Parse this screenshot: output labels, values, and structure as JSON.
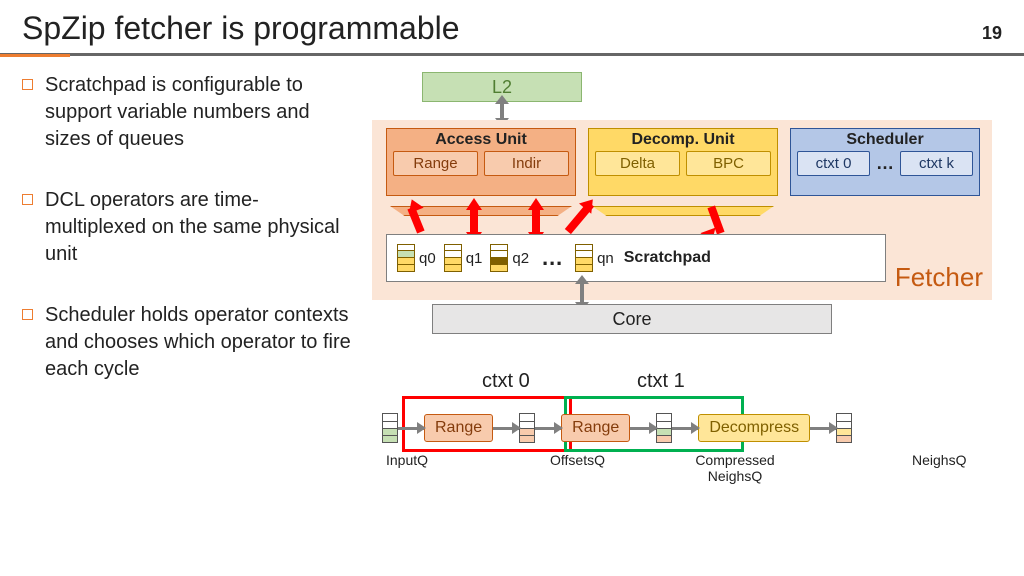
{
  "title": "SpZip fetcher is programmable",
  "page_number": "19",
  "bullets": [
    "Scratchpad is configurable to support variable numbers and sizes of queues",
    "DCL operators are time-multiplexed on the same physical unit",
    "Scheduler holds operator contexts and chooses which operator to fire each cycle"
  ],
  "diagram1": {
    "l2": "L2",
    "fetcher": "Fetcher",
    "access_unit": {
      "title": "Access Unit",
      "sub": [
        "Range",
        "Indir"
      ]
    },
    "decomp_unit": {
      "title": "Decomp. Unit",
      "sub": [
        "Delta",
        "BPC"
      ]
    },
    "scheduler": {
      "title": "Scheduler",
      "sub": [
        "ctxt 0",
        "ctxt k"
      ],
      "ellipsis": "…"
    },
    "scratchpad": {
      "label": "Scratchpad",
      "queues": [
        "q0",
        "q1",
        "q2",
        "qn"
      ],
      "ellipsis": "…"
    },
    "core": "Core"
  },
  "diagram2": {
    "ctxt0": "ctxt 0",
    "ctxt1": "ctxt 1",
    "ops": [
      "Range",
      "Range",
      "Decompress"
    ],
    "queue_labels": [
      "InputQ",
      "OffsetsQ",
      "Compressed NeighsQ",
      "NeighsQ"
    ]
  }
}
